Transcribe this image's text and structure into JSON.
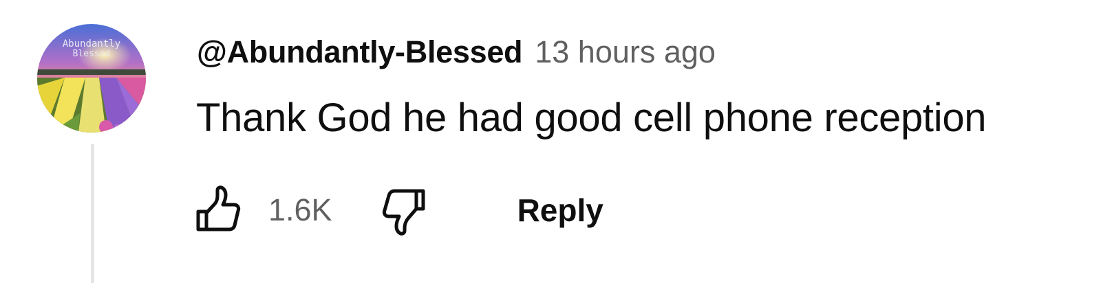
{
  "comment": {
    "author": "@Abundantly-Blessed",
    "timestamp": "13 hours ago",
    "text": "Thank God he had good cell phone reception",
    "avatar_text": [
      "Abundantly",
      "Blessed"
    ]
  },
  "actions": {
    "like_count": "1.6K",
    "reply_label": "Reply",
    "like_icon": "thumbs-up-icon",
    "dislike_icon": "thumbs-down-icon"
  },
  "colors": {
    "text_primary": "#0f0f0f",
    "text_secondary": "#606060",
    "thread_line": "#e5e5e5"
  }
}
